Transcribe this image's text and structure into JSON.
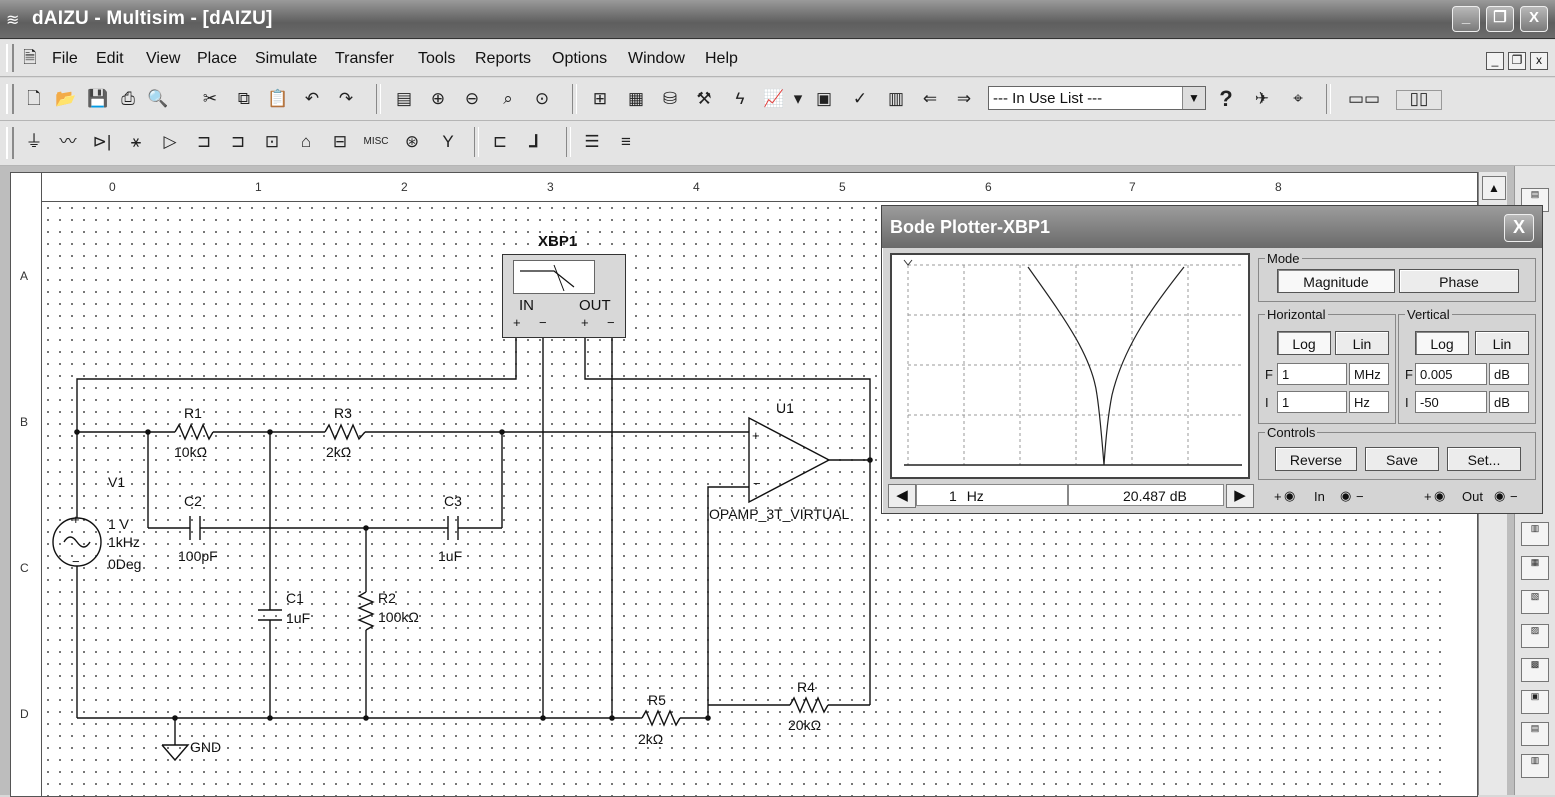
{
  "window": {
    "title": "dAIZU - Multisim - [dAIZU]",
    "min": "_",
    "max": "❐",
    "close": "X"
  },
  "menu": [
    "File",
    "Edit",
    "View",
    "Place",
    "Simulate",
    "Transfer",
    "Tools",
    "Reports",
    "Options",
    "Window",
    "Help"
  ],
  "mdi": {
    "min": "_",
    "restore": "❐",
    "close": "x"
  },
  "toolbar": {
    "in_use_list": "--- In Use List ---",
    "help": "?"
  },
  "ruler": {
    "columns": [
      "0",
      "1",
      "2",
      "3",
      "4",
      "5",
      "6",
      "7",
      "8"
    ],
    "rows": [
      "A",
      "B",
      "C",
      "D"
    ]
  },
  "schematic": {
    "xbp1_label": "XBP1",
    "xbp1_in": "IN",
    "xbp1_out": "OUT",
    "r1": "R1",
    "r1_val": "10kΩ",
    "r3": "R3",
    "r3_val": "2kΩ",
    "u1": "U1",
    "u1_model": "OPAMP_3T_VIRTUAL",
    "v1": "V1",
    "v1_amp": "1 V",
    "v1_freq": "1kHz",
    "v1_phase": "0Deg",
    "c2": "C2",
    "c2_val": "100pF",
    "c3": "C3",
    "c3_val": "1uF",
    "c1": "C1",
    "c1_val": "1uF",
    "r2": "R2",
    "r2_val": "100kΩ",
    "r5": "R5",
    "r5_val": "2kΩ",
    "r4": "R4",
    "r4_val": "20kΩ",
    "gnd": "GND",
    "plus": "+",
    "minus": "−"
  },
  "bode": {
    "title": "Bode Plotter-XBP1",
    "close": "X",
    "nav_freq": "1",
    "nav_freq_unit": "Hz",
    "nav_value": "20.487 dB",
    "mode_label": "Mode",
    "magnitude": "Magnitude",
    "phase": "Phase",
    "horizontal_label": "Horizontal",
    "vertical_label": "Vertical",
    "log": "Log",
    "lin": "Lin",
    "h_f_label": "F",
    "h_f_value": "1",
    "h_f_unit": "MHz",
    "h_i_label": "I",
    "h_i_value": "1",
    "h_i_unit": "Hz",
    "v_f_label": "F",
    "v_f_value": "0.005",
    "v_f_unit": "dB",
    "v_i_label": "I",
    "v_i_value": "-50",
    "v_i_unit": "dB",
    "controls_label": "Controls",
    "reverse": "Reverse",
    "save": "Save",
    "set": "Set...",
    "in_label": "In",
    "out_label": "Out",
    "plus": "+",
    "minus": "−"
  }
}
